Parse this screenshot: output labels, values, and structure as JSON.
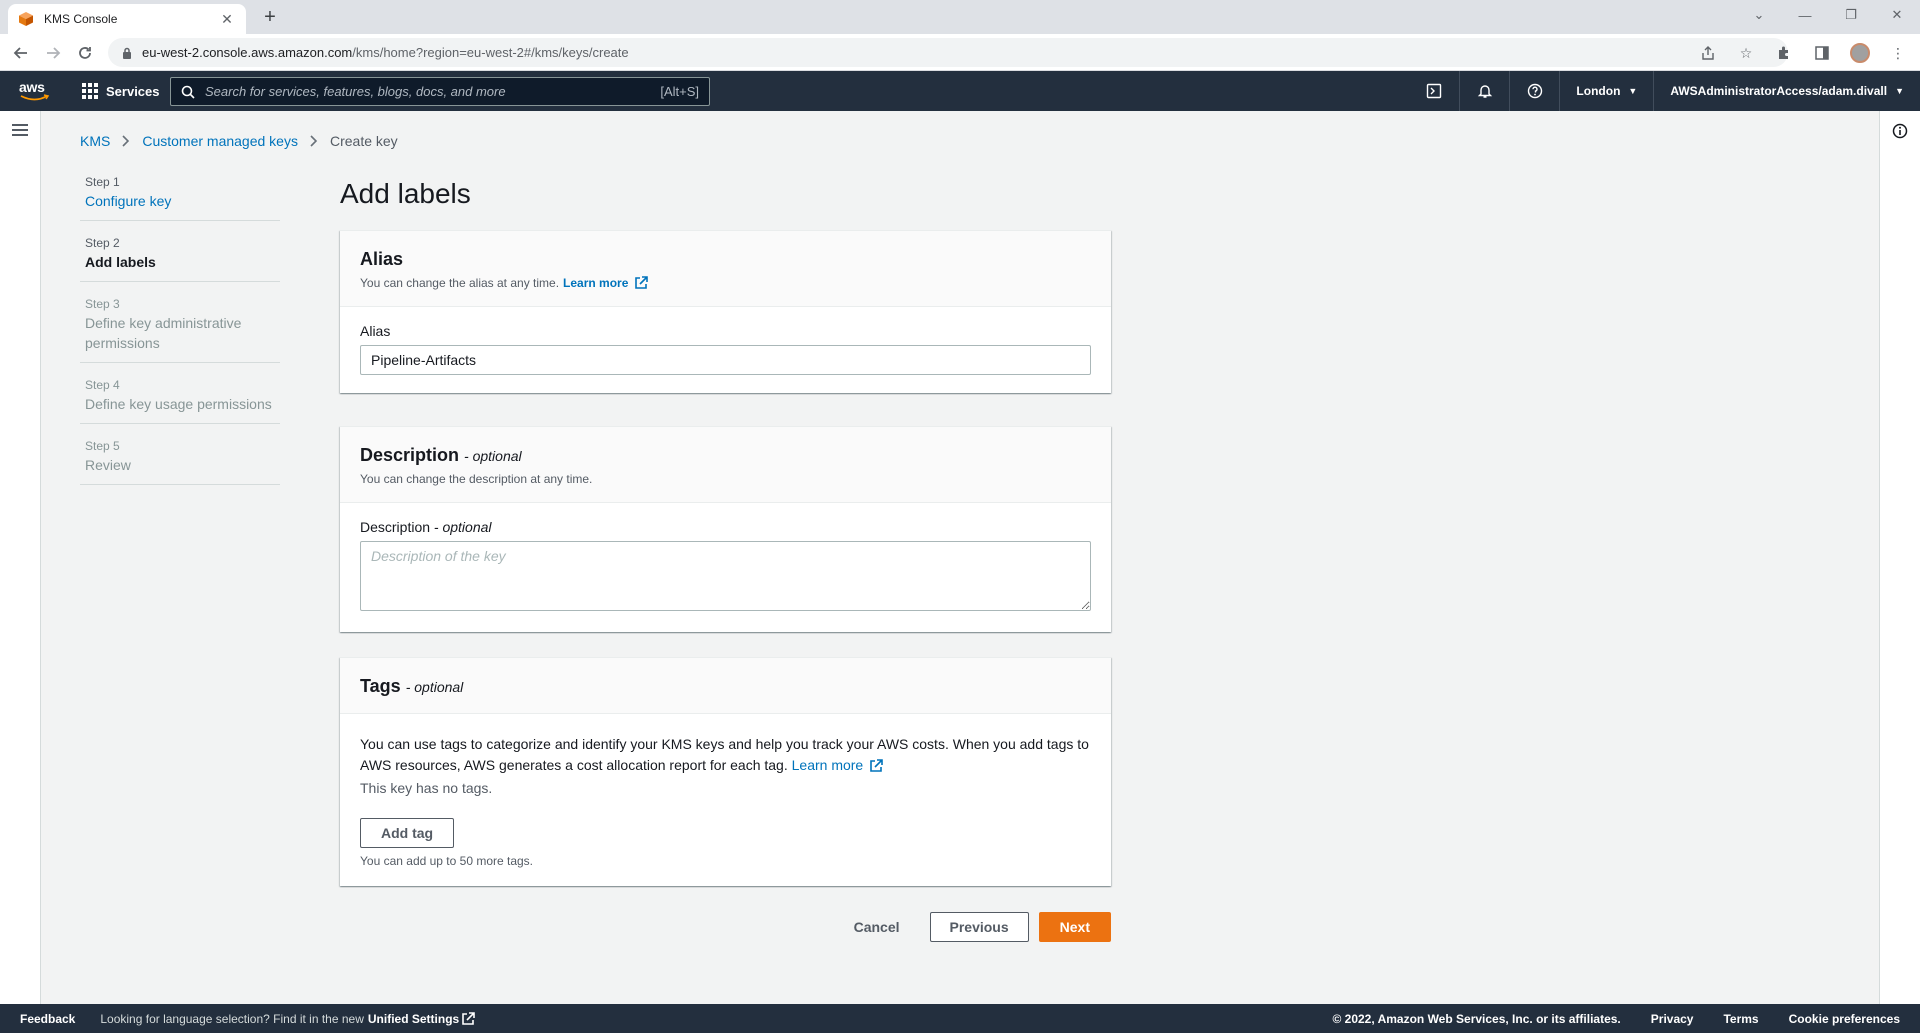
{
  "browser": {
    "tab_title": "KMS Console",
    "url_host": "eu-west-2.console.aws.amazon.com",
    "url_path": "/kms/home?region=eu-west-2#/kms/keys/create"
  },
  "aws_header": {
    "logo_text": "aws",
    "services_label": "Services",
    "search_placeholder": "Search for services, features, blogs, docs, and more",
    "search_shortcut": "[Alt+S]",
    "region": "London",
    "account": "AWSAdministratorAccess/adam.divall"
  },
  "breadcrumb": {
    "items": [
      "KMS",
      "Customer managed keys"
    ],
    "current": "Create key"
  },
  "wizard_steps": [
    {
      "num": "Step 1",
      "label": "Configure key",
      "state": "done"
    },
    {
      "num": "Step 2",
      "label": "Add labels",
      "state": "active"
    },
    {
      "num": "Step 3",
      "label": "Define key administrative permissions",
      "state": "todo"
    },
    {
      "num": "Step 4",
      "label": "Define key usage permissions",
      "state": "todo"
    },
    {
      "num": "Step 5",
      "label": "Review",
      "state": "todo"
    }
  ],
  "page_title": "Add labels",
  "alias_panel": {
    "title": "Alias",
    "description": "You can change the alias at any time.",
    "learn_more": "Learn more",
    "field_label": "Alias",
    "value": "Pipeline-Artifacts"
  },
  "description_panel": {
    "title": "Description",
    "optional": "- optional",
    "description": "You can change the description at any time.",
    "field_label": "Description",
    "field_optional": "- optional",
    "placeholder": "Description of the key"
  },
  "tags_panel": {
    "title": "Tags",
    "optional": "- optional",
    "text": "You can use tags to categorize and identify your KMS keys and help you track your AWS costs. When you add tags to AWS resources, AWS generates a cost allocation report for each tag.",
    "learn_more": "Learn more",
    "no_tags": "This key has no tags.",
    "add_tag": "Add tag",
    "hint": "You can add up to 50 more tags."
  },
  "actions": {
    "cancel": "Cancel",
    "previous": "Previous",
    "next": "Next"
  },
  "footer": {
    "feedback": "Feedback",
    "lang_text": "Looking for language selection? Find it in the new",
    "lang_link": "Unified Settings",
    "copyright": "© 2022, Amazon Web Services, Inc. or its affiliates.",
    "privacy": "Privacy",
    "terms": "Terms",
    "cookies": "Cookie preferences"
  },
  "colors": {
    "aws_nav": "#232f3e",
    "link": "#0073bb",
    "primary_button": "#ec7211"
  }
}
